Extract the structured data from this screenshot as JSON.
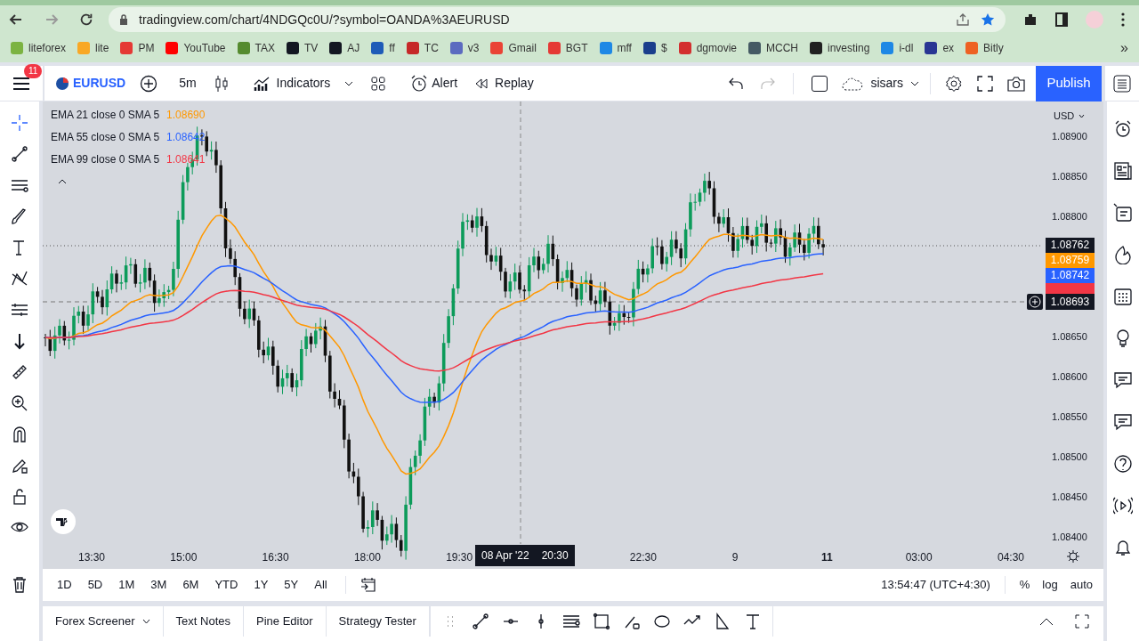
{
  "browser": {
    "url": "tradingview.com/chart/4NDGQc0U/?symbol=OANDA%3AEURUSD",
    "bookmarks": [
      {
        "label": "liteforex",
        "color": "#7cb342"
      },
      {
        "label": "lite",
        "color": "#f9a825"
      },
      {
        "label": "PM",
        "color": "#e53935"
      },
      {
        "label": "YouTube",
        "color": "#ff0000"
      },
      {
        "label": "TAX",
        "color": "#558b2f"
      },
      {
        "label": "TV",
        "color": "#131722"
      },
      {
        "label": "AJ",
        "color": "#131722"
      },
      {
        "label": "ff",
        "color": "#1e5bb8"
      },
      {
        "label": "TC",
        "color": "#c62828"
      },
      {
        "label": "v3",
        "color": "#5c6bc0"
      },
      {
        "label": "Gmail",
        "color": "#ea4335"
      },
      {
        "label": "BGT",
        "color": "#e53935"
      },
      {
        "label": "mff",
        "color": "#1e88e5"
      },
      {
        "label": "$",
        "color": "#1a3e8c"
      },
      {
        "label": "dgmovie",
        "color": "#d32f2f"
      },
      {
        "label": "MCCH",
        "color": "#455a64"
      },
      {
        "label": "investing",
        "color": "#212121"
      },
      {
        "label": "i-dl",
        "color": "#1e88e5"
      },
      {
        "label": "ex",
        "color": "#283593"
      },
      {
        "label": "Bitly",
        "color": "#ee6123"
      }
    ],
    "overflow": "»"
  },
  "toolbar": {
    "menu_badge": "11",
    "symbol": "EURUSD",
    "interval": "5m",
    "indicators": "Indicators",
    "alert": "Alert",
    "replay": "Replay",
    "layout_name": "sisars",
    "publish": "Publish"
  },
  "legend": [
    {
      "label": "EMA 21 close 0 SMA 5",
      "value": "1.08690",
      "color": "#ff9800"
    },
    {
      "label": "EMA 55 close 0 SMA 5",
      "value": "1.08642",
      "color": "#2962ff"
    },
    {
      "label": "EMA 99 close 0 SMA 5",
      "value": "1.08641",
      "color": "#f23645"
    }
  ],
  "price_axis": {
    "currency": "USD",
    "ticks": [
      "1.08900",
      "1.08850",
      "1.08800",
      "1.08650",
      "1.08600",
      "1.08550",
      "1.08500",
      "1.08450",
      "1.08400"
    ]
  },
  "price_labels": [
    {
      "value": "1.08762",
      "color": "#131722"
    },
    {
      "value": "1.08759",
      "color": "#ff9800"
    },
    {
      "value": "1.08742",
      "color": "#2962ff"
    }
  ],
  "crosshair": {
    "price": "1.08693",
    "time": "08 Apr '22",
    "time_of_day": "20:30"
  },
  "time_axis": [
    {
      "label": "13:30",
      "bold": false
    },
    {
      "label": "15:00",
      "bold": false
    },
    {
      "label": "16:30",
      "bold": false
    },
    {
      "label": "18:00",
      "bold": false
    },
    {
      "label": "19:30",
      "bold": false
    },
    {
      "label": "22:30",
      "bold": false
    },
    {
      "label": "9",
      "bold": false
    },
    {
      "label": "11",
      "bold": true
    },
    {
      "label": "03:00",
      "bold": false
    },
    {
      "label": "04:30",
      "bold": false
    }
  ],
  "ranges": [
    "1D",
    "5D",
    "1M",
    "3M",
    "6M",
    "YTD",
    "1Y",
    "5Y",
    "All"
  ],
  "clock": "13:54:47 (UTC+4:30)",
  "scale_options": [
    "%",
    "log",
    "auto"
  ],
  "bottom_tabs": [
    {
      "label": "Forex Screener",
      "dropdown": true
    },
    {
      "label": "Text Notes",
      "dropdown": false
    },
    {
      "label": "Pine Editor",
      "dropdown": false
    },
    {
      "label": "Strategy Tester",
      "dropdown": false
    }
  ]
}
